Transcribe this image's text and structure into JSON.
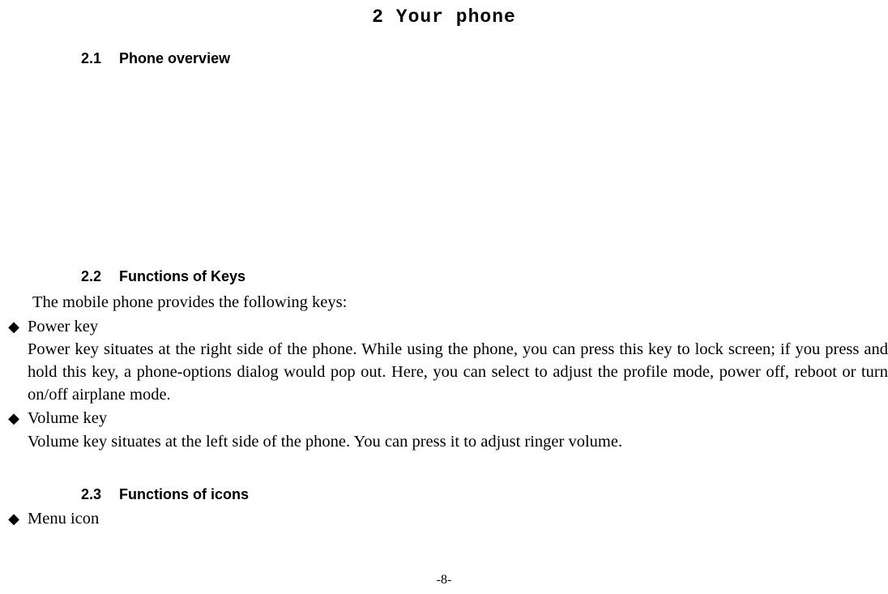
{
  "title": "2 Your phone",
  "sections": {
    "s1": {
      "num": "2.1",
      "title": "Phone overview"
    },
    "s2": {
      "num": "2.2",
      "title": "Functions of Keys",
      "intro": "The mobile phone provides the following keys:",
      "bullets": [
        {
          "label": "Power key",
          "desc": "Power key situates at the right side of the phone. While using the phone, you can press this key to lock screen; if you press and hold this key, a phone-options dialog would pop out. Here, you can select to adjust the profile mode, power off, reboot or turn on/off airplane mode."
        },
        {
          "label": "Volume key",
          "desc": "Volume key situates at the left side of the phone. You can press it to adjust ringer volume."
        }
      ]
    },
    "s3": {
      "num": "2.3",
      "title": "Functions of icons",
      "bullets": [
        {
          "label": "Menu icon"
        }
      ]
    }
  },
  "pageNumber": "-8-"
}
